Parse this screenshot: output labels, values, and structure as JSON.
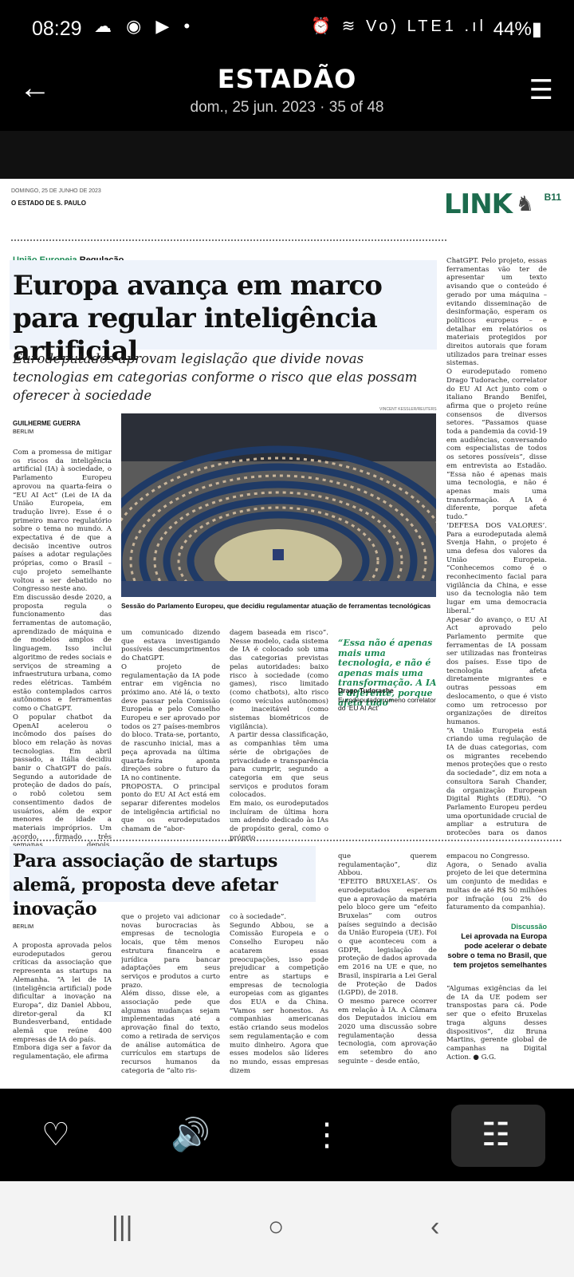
{
  "status_bar": {
    "time": "08:29",
    "left_icons": "☁ ◉ ▶ •",
    "right_icons": "⏰ ≋ Vo) LTE1 .ıl",
    "battery": "44%▮"
  },
  "app_bar": {
    "brand": "ESTADÃO",
    "subtitle": "dom., 25 jun. 2023 · 35 of 48",
    "back_icon": "back-arrow-icon",
    "menu_icon": "list-menu-icon"
  },
  "page": {
    "date": "DOMINGO, 25 DE JUNHO DE 2023",
    "paper": "O ESTADO DE S. PAULO",
    "section": "LINK",
    "page_number": "B11",
    "kicker_green": "União Europeia",
    "kicker_tag": "Regulação",
    "headline": "Europa avança em marco para regular inteligência artificial",
    "dek": "Eurodeputados aprovam legislação que divide novas tecnologias em categorias conforme o risco que elas possam oferecer à sociedade",
    "photo_credit": "VINCENT KESSLER/REUTERS",
    "photo_caption": "Sessão do Parlamento Europeu, que decidiu regulamentar atuação de ferramentas tecnológicas",
    "byline": "GUILHERME GUERRA",
    "dateline": "BERLIM",
    "col1": "Com a promessa de mitigar os riscos da inteligência artificial (IA) à sociedade, o Parlamento Europeu aprovou na quarta-feira o “EU AI Act” (Lei de IA da União Europeia, em tradução livre). Esse é o primeiro marco regulatório sobre o tema no mundo. A expectativa é de que a decisão incentive outros países a adotar regulações próprias, como o Brasil – cujo projeto semelhante voltou a ser debatido no Congresso neste ano.\nEm discussão desde 2020, a proposta regula o funcionamento das ferramentas de automação, aprendizado de máquina e de modelos amplos de linguagem. Isso inclui algoritmo de redes sociais e serviços de streaming a infraestrutura urbana, como redes elétricas. Também estão contemplados carros autônomos e ferramentas como o ChatGPT.\nO popular chatbot da OpenAI acelerou o incômodo dos países do bloco em relação às novas tecnologias. Em abril passado, a Itália decidiu banir o ChatGPT do país. Segundo a autoridade de proteção de dados do país, o robô coletou sem consentimento dados de usuários, além de expor menores de idade a materiais impróprios. Um acordo, firmado três semanas depois, restabeleceu o serviço. Poucos dias depois, a autoridade de dados da Espanha emitiu",
    "col2": "um comunicado dizendo que estava investigando possíveis descumprimentos do ChatGPT.\nO projeto de regulamentação da IA pode entrar em vigência no próximo ano. Até lá, o texto deve passar pela Comissão Europeia e pelo Conselho Europeu e ser aprovado por todos os 27 países-membros do bloco. Trata-se, portanto, de rascunho inicial, mas a peça aprovada na última quarta-feira aponta direções sobre o futuro da IA no continente.\nPROPOSTA. O principal ponto do EU AI Act está em separar diferentes modelos de inteligência artificial no que os eurodeputados chamam de “abor-",
    "col3": "dagem baseada em risco”. Nesse modelo, cada sistema de IA é colocado sob uma das categorias previstas pelas autoridades: baixo risco à sociedade (como games), risco limitado (como chatbots), alto risco (como veículos autônomos) e inaceitável (como sistemas biométricos de vigilância).\nA partir dessa classificação, as companhias têm uma série de obrigações de privacidade e transparência para cumprir, segundo a categoria em que seus serviços e produtos foram colocados.\nEm maio, os eurodeputados incluíram de última hora um adendo dedicado às IAs de propósito geral, como o próprio",
    "pullquote": "“Essa não é apenas mais uma tecnologia, e não é apenas mais uma transformação. A IA é diferente, porque afeta tudo”",
    "pq_name": "Drago Tudorache",
    "pq_role": "Eurodeputado romeno correlator do ‘EU AI Act’",
    "col4": "ChatGPT. Pelo projeto, essas ferramentas vão ter de apresentar um texto avisando que o conteúdo é gerado por uma máquina – evitando disseminação de desinformação, esperam os políticos europeus – e detalhar em relatórios os materiais protegidos por direitos autorais que foram utilizados para treinar esses sistemas.\nO eurodeputado romeno Drago Tudorache, correlator do EU AI Act junto com o italiano Brando Benifei, afirma que o projeto reúne consensos de diversos setores. “Passamos quase toda a pandemia da covid-19 em audiências, conversando com especialistas de todos os setores possíveis”, disse em entrevista ao Estadão. “Essa não é apenas mais uma tecnologia, e não é apenas mais uma transformação. A IA é diferente, porque afeta tudo.”\n‘DEFESA DOS VALORES’. Para a eurodeputada alemã Svenja Hahn, o projeto é uma defesa dos valores da União Europeia. “Conhecemos como é o reconhecimento facial para vigilância da China, e esse uso da tecnologia não tem lugar em uma democracia liberal.”\nApesar do avanço, o EU AI Act aprovado pelo Parlamento permite que ferramentas de IA possam ser utilizadas nas fronteiras dos países. Esse tipo de tecnologia afeta diretamente migrantes e outras pessoas em deslocamento, o que é visto como um retrocesso por organizações de direitos humanos.\n“A União Europeia está criando uma regulação de IA de duas categorias, com os migrantes recebendo menos proteções que o resto da sociedade”, diz em nota a consultora Sarah Chander, da organização European Digital Rights (EDRi). “O Parlamento Europeu perdeu uma oportunidade crucial de ampliar a estrutura de proteções para os danos causados pela IA.” ● O REPÓRTER ESTÁ EM BERLIM COMO PARTE DO INTERNATIONAL JOURNALISTS PROGRAMME (IJP), PROGRAMA DE INTERCÂMBIO PARA JORNALISTAS DA AMÉRICA LATINA",
    "headline2": "Para associação de startups alemã, proposta deve afetar inovação",
    "dateline2": "BERLIM",
    "b_col1": "A proposta aprovada pelos eurodeputados gerou críticas da associação que representa as startups na Alemanha. “A lei de IA (inteligência artificial) pode dificultar a inovação na Europa”, diz Daniel Abbou, diretor-geral da KI Bundesverband, entidade alemã que reúne 400 empresas de IA do país.\nEmbora diga ser a favor da regulamentação, ele afirma",
    "b_col2": "que o projeto vai adicionar novas burocracias às empresas de tecnologia locais, que têm menos estrutura financeira e jurídica para bancar adaptações em seus serviços e produtos a curto prazo.\nAlém disso, disse ele, a associação pede que algumas mudanças sejam implementadas até a aprovação final do texto, como a retirada de serviços de análise automática de currículos em startups de recursos humanos da categoria de “alto ris-",
    "b_col3": "co à sociedade”.\nSegundo Abbou, se a Comissão Europeia e o Conselho Europeu não acatarem essas preocupações, isso pode prejudicar a competição entre as startups e empresas de tecnologia europeias com as gigantes dos EUA e da China. “Vamos ser honestos. As companhias americanas estão criando seus modelos sem regulamentação e com muito dinheiro. Agora que esses modelos são líderes no mundo, essas empresas dizem",
    "b_col4": "que querem regulamentação”, diz Abbou.\n‘EFEITO BRUXELAS’. Os eurodeputados esperam que a aprovação da matéria pelo bloco gere um “efeito Bruxelas” com outros países seguindo a decisão da União Europeia (UE). Foi o que aconteceu com a GDPR, legislação de proteção de dados aprovada em 2016 na UE e que, no Brasil, inspiraria a Lei Geral de Proteção de Dados (LGPD), de 2018.\nO mesmo parece ocorrer em relação à IA. A Câmara dos Deputados iniciou em 2020 uma discussão sobre regulamentação dessa tecnologia, com aprovação em setembro do ano seguinte – desde então,",
    "b_col5": "empacou no Congresso.\nAgora, o Senado avalia projeto de lei que determina um conjunto de medidas e multas de até R$ 50 milhões por infração (ou 2% do faturamento da companhia).",
    "sidebox_title": "Discussão",
    "sidebox_text": "Lei aprovada na Europa pode acelerar o debate sobre o tema no Brasil, que tem projetos semelhantes",
    "sidebox_body": "“Algumas exigências da lei de IA da UE podem ser transpostas para cá. Pode ser que o efeito Bruxelas traga alguns desses dispositivos”, diz Bruna Martins, gerente global de campanhas na Digital Action. ● G.G."
  },
  "bottom_nav": {
    "favorite_icon": "♡",
    "audio_icon": "🔊",
    "more_icon": "⋮",
    "view_icon": "☷"
  },
  "system_nav": {
    "recents": "|||",
    "home": "○",
    "back": "‹"
  },
  "colors": {
    "accent_green": "#1c8a55",
    "headline_bg": "#eef3fb",
    "bar_bg": "#000000"
  }
}
